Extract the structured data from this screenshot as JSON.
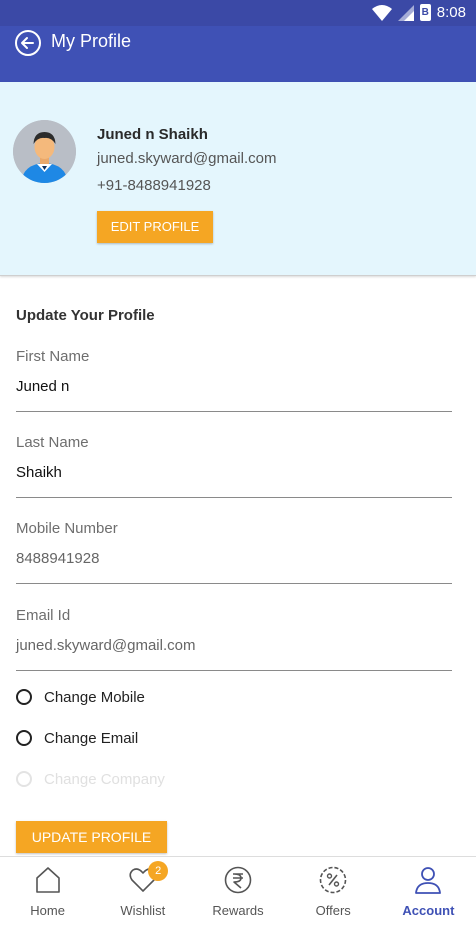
{
  "status_bar": {
    "time": "8:08",
    "battery_glyph": "B"
  },
  "header": {
    "title": "My Profile",
    "back_icon": "arrow-left-circle-icon"
  },
  "profile": {
    "name": "Juned n Shaikh",
    "email": "juned.skyward@gmail.com",
    "phone": "+91-8488941928",
    "edit_label": "EDIT PROFILE"
  },
  "form": {
    "section_title": "Update Your Profile",
    "fields": [
      {
        "label": "First Name",
        "value": "Juned n"
      },
      {
        "label": "Last Name",
        "value": "Shaikh"
      },
      {
        "label": "Mobile Number",
        "value": "8488941928"
      },
      {
        "label": "Email Id",
        "value": "juned.skyward@gmail.com"
      }
    ],
    "options": [
      {
        "label": "Change Mobile",
        "enabled": true
      },
      {
        "label": "Change Email",
        "enabled": true
      },
      {
        "label": "Change Company",
        "enabled": false
      }
    ],
    "update_label": "UPDATE PROFILE"
  },
  "bottom_nav": {
    "items": [
      {
        "label": "Home",
        "icon": "home-icon"
      },
      {
        "label": "Wishlist",
        "icon": "heart-icon",
        "badge": "2"
      },
      {
        "label": "Rewards",
        "icon": "rupee-icon"
      },
      {
        "label": "Offers",
        "icon": "percent-badge-icon"
      },
      {
        "label": "Account",
        "icon": "user-icon",
        "active": true
      }
    ]
  },
  "colors": {
    "primary": "#3f51b5",
    "accent": "#f5a623",
    "card_bg": "#e4f6fd"
  }
}
